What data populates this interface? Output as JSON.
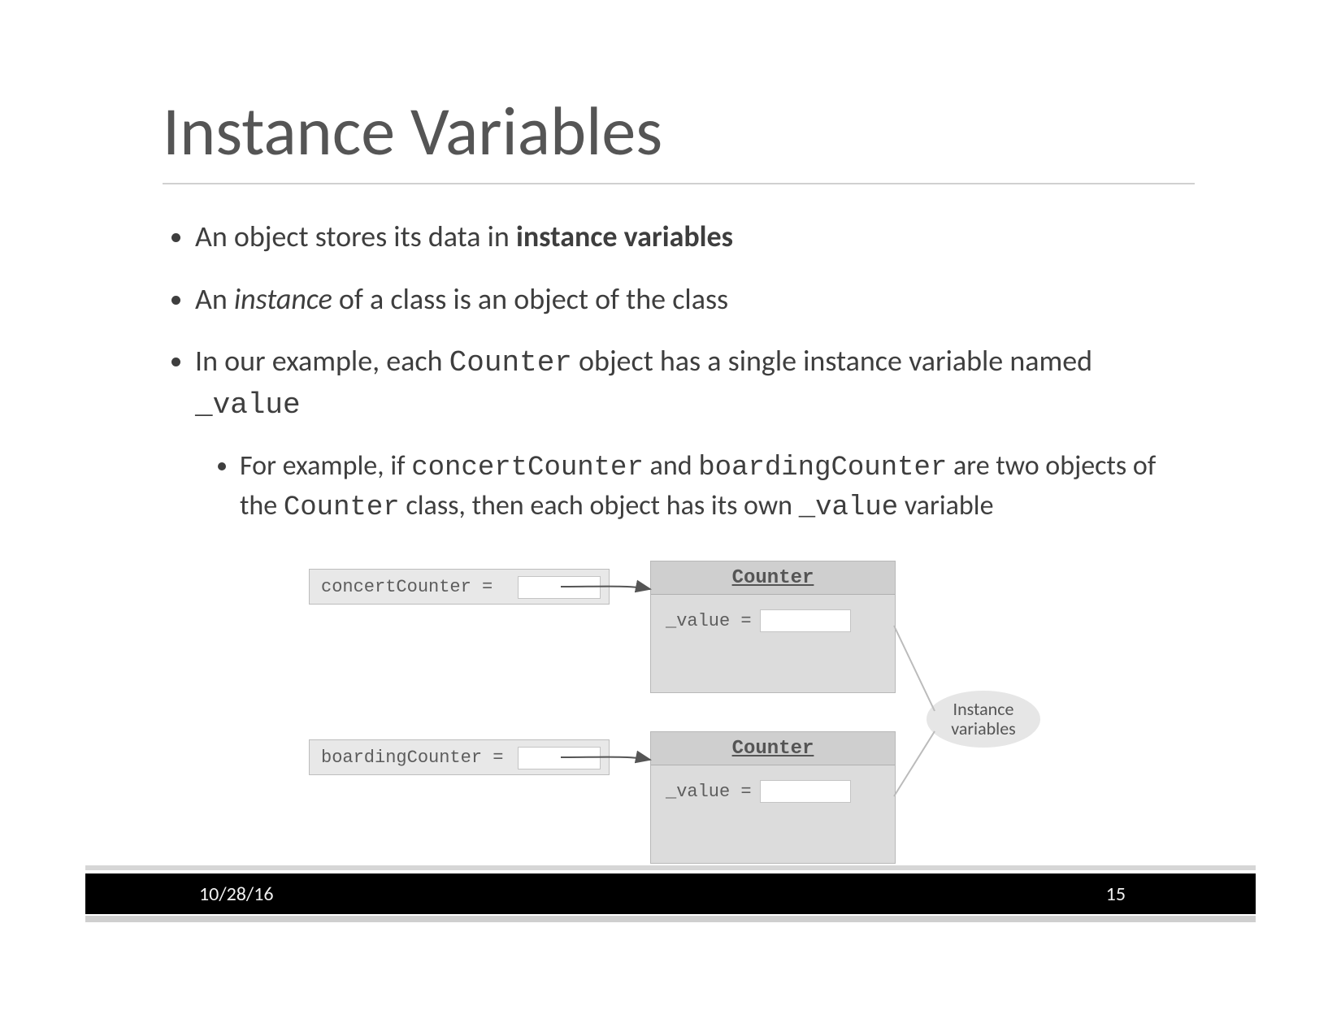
{
  "title": "Instance Variables",
  "bullets": {
    "b1_pre": "An object stores its data in ",
    "b1_bold": "instance variables",
    "b2_pre": "An ",
    "b2_ital": "instance",
    "b2_post": " of a class is an object of the class",
    "b3_pre": "In our example, each ",
    "b3_code1": "Counter",
    "b3_mid": " object has a single instance variable named ",
    "b3_code2": "_value",
    "sub1_pre": "For example, if ",
    "sub1_code1": "concertCounter",
    "sub1_mid1": " and ",
    "sub1_code2": "boardingCounter",
    "sub1_mid2": " are two objects of the ",
    "sub1_code3": "Counter",
    "sub1_mid3": " class, then each object has its own ",
    "sub1_code4": "_value",
    "sub1_post": " variable"
  },
  "diagram": {
    "ref1_label": "concertCounter =",
    "ref2_label": "boardingCounter =",
    "obj_header": "Counter",
    "field_label": "_value =",
    "callout": "Instance variables"
  },
  "footer": {
    "date": "10/28/16",
    "page": "15"
  }
}
